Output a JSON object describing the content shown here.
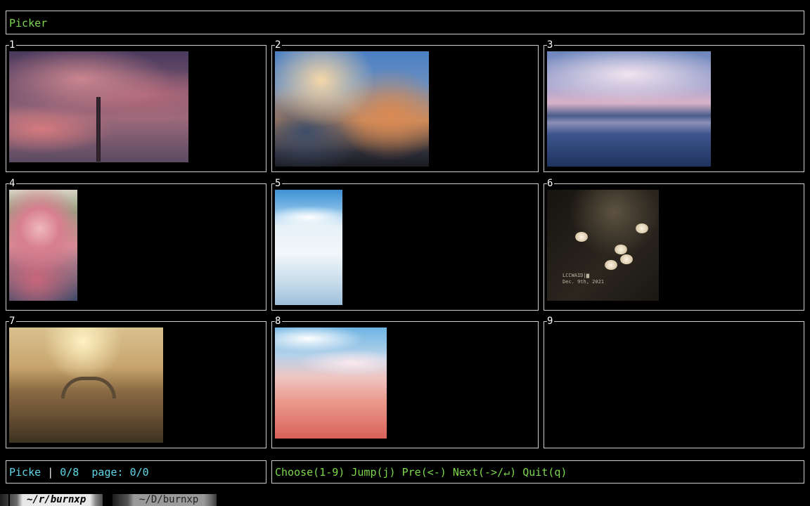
{
  "header": {
    "title": "Picker"
  },
  "grid": {
    "cells": [
      {
        "index": "1",
        "has_image": true
      },
      {
        "index": "2",
        "has_image": true
      },
      {
        "index": "3",
        "has_image": true
      },
      {
        "index": "4",
        "has_image": true
      },
      {
        "index": "5",
        "has_image": true
      },
      {
        "index": "6",
        "has_image": true,
        "watermark_line1": "LCCWAID|▆",
        "watermark_line2": "Dec. 9th, 2021"
      },
      {
        "index": "7",
        "has_image": true
      },
      {
        "index": "8",
        "has_image": true
      },
      {
        "index": "9",
        "has_image": false
      }
    ]
  },
  "status": {
    "mode": "Picke",
    "separator": "|",
    "count": "0/8",
    "page_label": "page:",
    "page_value": "0/0",
    "help": "Choose(1-9) Jump(j) Pre(<-) Next(->/↵) Quit(q)"
  },
  "tabs": [
    {
      "label": "~/r/burnxp",
      "active": true
    },
    {
      "label": "~/D/burnxp",
      "active": false
    }
  ],
  "colors": {
    "title": "#7cd74d",
    "help": "#7cd74d",
    "status": "#5fd7e8",
    "border": "#cfcfcf",
    "background": "#000000"
  }
}
